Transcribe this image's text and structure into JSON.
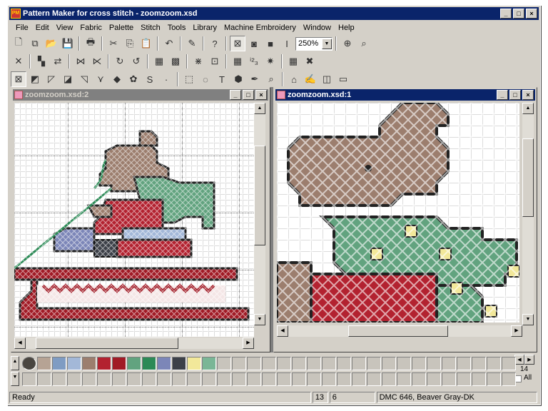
{
  "app": {
    "title": "Pattern Maker for cross stitch - zoomzoom.xsd",
    "icon_text": "PM"
  },
  "caption_buttons": {
    "minimize": "_",
    "maximize": "□",
    "close": "×"
  },
  "menu": [
    "File",
    "Edit",
    "View",
    "Fabric",
    "Palette",
    "Stitch",
    "Tools",
    "Library",
    "Machine Embroidery",
    "Window",
    "Help"
  ],
  "toolbar1": {
    "icons": [
      "new-file-icon",
      "new-from-template-icon",
      "open-folder-icon",
      "save-icon",
      "print-icon",
      "cut-icon",
      "copy-icon",
      "paste-icon",
      "undo-icon",
      "wizard-icon",
      "help-icon",
      "view-cross-icon",
      "view-filled-icon",
      "view-solid-icon",
      "view-text-icon",
      "fit-icon",
      "zoom-icon"
    ],
    "glyphs": [
      "🗋",
      "⧉",
      "📂",
      "💾",
      "🖶",
      "✂",
      "⎘",
      "📋",
      "↶",
      "✎",
      "?",
      "⊠",
      "◙",
      "■",
      "I",
      "⊕",
      "⌕"
    ],
    "zoom": "250%"
  },
  "toolbar2": {
    "icons": [
      "delete-icon",
      "recolor-icon",
      "swap-icon",
      "flip-h-icon",
      "flip-v-icon",
      "rotate-left-icon",
      "rotate-right-icon",
      "select-color-icon",
      "select-area-icon",
      "transparent-icon",
      "grid-icon",
      "palette-view-icon",
      "char-icon",
      "star-icon",
      "grid-toggle-icon",
      "cross-highlight-icon"
    ],
    "glyphs": [
      "✕",
      "▚",
      "⇄",
      "⋈",
      "⋉",
      "↻",
      "↺",
      "▦",
      "▩",
      "⋇",
      "⊡",
      "▦",
      "ⁱ²₃",
      "✷",
      "▦",
      "✖"
    ]
  },
  "toolbar3": {
    "icons": [
      "full-cross-icon",
      "three-quarter-icon",
      "half-stitch-icon",
      "quarter-stitch-icon",
      "backstitch-icon",
      "french-knot-icon",
      "bead-icon",
      "petite-icon",
      "special-stitch-icon",
      "dot-icon",
      "rect-select-icon",
      "lasso-icon",
      "text-icon",
      "fill-icon",
      "eyedropper-icon",
      "magnify-icon",
      "stitch-machine-icon",
      "needle-icon",
      "split-icon",
      "layout-icon"
    ],
    "glyphs": [
      "⊠",
      "◩",
      "◸",
      "◪",
      "◹",
      "⋎",
      "◆",
      "✿",
      "S",
      "·",
      "⬚",
      "◌",
      "T",
      "⬢",
      "✒",
      "⌕",
      "⌂",
      "✍",
      "◫",
      "▭"
    ]
  },
  "windows": [
    {
      "title": "zoomzoom.xsd:2",
      "state": "inactive"
    },
    {
      "title": "zoomzoom.xsd:1",
      "state": "active"
    }
  ],
  "palette": {
    "colors": [
      "#4a4640",
      "#b6a394",
      "#7f9cc3",
      "#a3b8d8",
      "#9c7e6e",
      "#b32230",
      "#a11a25",
      "#62a37f",
      "#2c8a56",
      "#7c86b8",
      "#3c4048",
      "#f2e89a",
      "#7ab696"
    ],
    "count": "14",
    "all_label": "All"
  },
  "status": {
    "text": "Ready",
    "x": "13",
    "y": "6",
    "thread": "DMC  646, Beaver Gray-DK"
  }
}
